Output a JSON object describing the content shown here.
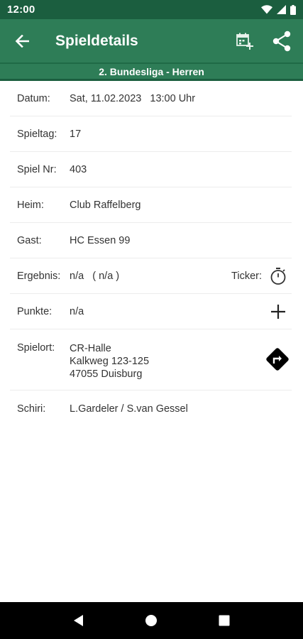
{
  "status_bar": {
    "time": "12:00"
  },
  "app_bar": {
    "title": "Spieldetails"
  },
  "league": "2. Bundesliga - Herren",
  "details": {
    "datum": {
      "label": "Datum:",
      "value": "Sat, 11.02.2023   13:00 Uhr"
    },
    "spieltag": {
      "label": "Spieltag:",
      "value": "17"
    },
    "spiel_nr": {
      "label": "Spiel Nr:",
      "value": "403"
    },
    "heim": {
      "label": "Heim:",
      "value": "Club Raffelberg"
    },
    "gast": {
      "label": "Gast:",
      "value": "HC Essen 99"
    },
    "ergebnis": {
      "label": "Ergebnis:",
      "value": "n/a   ( n/a )",
      "ticker_label": "Ticker:"
    },
    "punkte": {
      "label": "Punkte:",
      "value": "n/a"
    },
    "spielort": {
      "label": "Spielort:",
      "name": "CR-Halle",
      "street": "Kalkweg 123-125",
      "city": "47055 Duisburg"
    },
    "schiri": {
      "label": "Schiri:",
      "value": "L.Gardeler / S.van Gessel"
    }
  },
  "icons": {
    "back": "arrow-left-icon",
    "calendar_add": "calendar-add-icon",
    "share": "share-icon",
    "stopwatch": "stopwatch-icon",
    "add": "plus-icon",
    "directions": "directions-icon"
  },
  "colors": {
    "status_bar": "#1b5e3f",
    "app_bar": "#2e7d57",
    "nav_bar": "#000000"
  }
}
